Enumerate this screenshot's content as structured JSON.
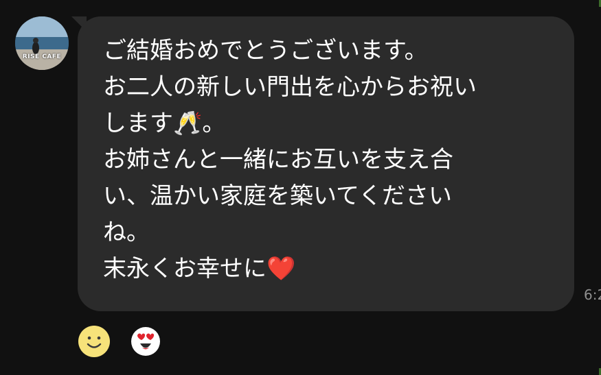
{
  "sender": {
    "avatar_label": "RISE CAFE"
  },
  "message": {
    "lines": [
      "ご結婚おめでとうございます。",
      "お二人の新しい門出を心からお祝い",
      "します🥂。",
      "お姉さんと一緒にお互いを支え合",
      "い、温かい家庭を築いてください",
      "ね。",
      "末永くお幸せに❤️"
    ],
    "timestamp": "6:2"
  },
  "reactions": [
    {
      "icon": "smile-icon"
    },
    {
      "icon": "heart-eyes-icon"
    }
  ],
  "colors": {
    "background": "#111111",
    "bubble": "#2b2b2b",
    "text": "#ffffff",
    "timestamp": "#8f8f8f",
    "heart": "#e0242e",
    "smile_face": "#f6e27a"
  }
}
